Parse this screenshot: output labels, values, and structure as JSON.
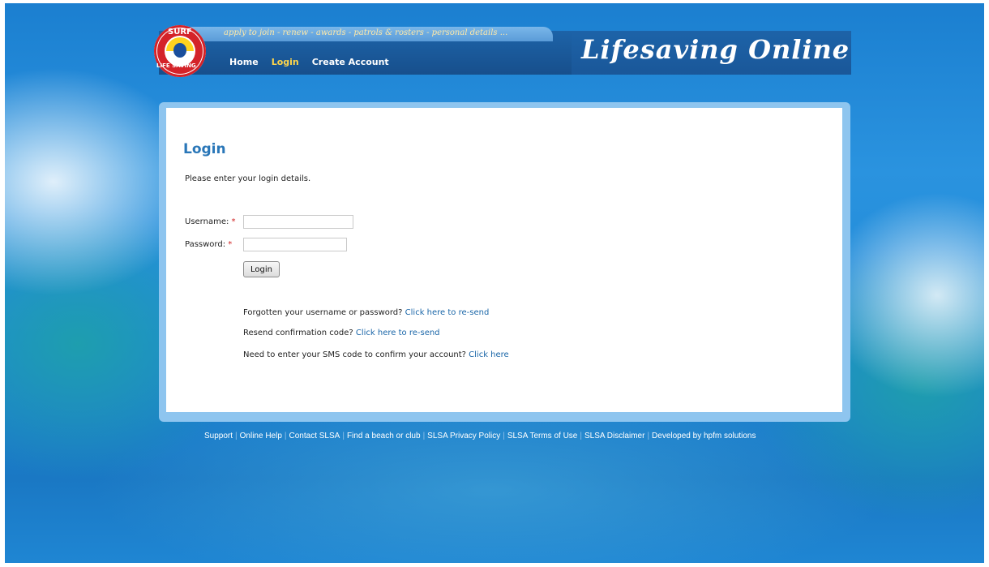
{
  "header": {
    "tagline": "apply to join - renew - awards - patrols & rosters - personal details ...",
    "brand": "Lifesaving Online",
    "logo_top": "SURF",
    "logo_bottom": "LIFE SAVING",
    "nav": [
      {
        "label": "Home",
        "active": false
      },
      {
        "label": "Login",
        "active": true
      },
      {
        "label": "Create Account",
        "active": false
      }
    ]
  },
  "login": {
    "title": "Login",
    "intro": "Please enter your login details.",
    "username_label": "Username:",
    "password_label": "Password:",
    "required_marker": "*",
    "username_value": "",
    "password_value": "",
    "button_label": "Login"
  },
  "help": [
    {
      "text": "Forgotten your username or password?",
      "link": "Click here to re-send"
    },
    {
      "text": "Resend confirmation code?",
      "link": "Click here to re-send"
    },
    {
      "text": "Need to enter your SMS code to confirm your account?",
      "link": "Click here"
    }
  ],
  "footer": {
    "links": [
      "Support",
      "Online Help",
      "Contact SLSA",
      "Find a beach or club",
      "SLSA Privacy Policy",
      "SLSA Terms of Use",
      "SLSA Disclaimer",
      "Developed by hpfm solutions"
    ],
    "separator": "|"
  },
  "colors": {
    "accent": "#2a77b8",
    "nav_active": "#ffd54a",
    "required": "#d02020",
    "header_bg": "#1d63a8"
  }
}
